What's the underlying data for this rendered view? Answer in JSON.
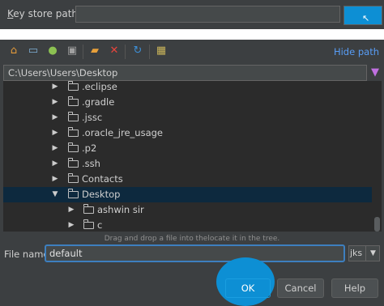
{
  "key_store": {
    "label_key": "K",
    "label_rest": "ey store path:",
    "value": ""
  },
  "toolbar": {
    "icons": [
      "home-icon",
      "desktop-icon",
      "android-icon",
      "project-folder-icon",
      "new-folder-icon",
      "delete-icon",
      "refresh-icon",
      "show-hidden-icon"
    ],
    "hide_path": "Hide path"
  },
  "path": {
    "value": "C:\\Users\\Users\\Desktop"
  },
  "tree": {
    "items": [
      {
        "label": ".eclipse",
        "arrow": "▶"
      },
      {
        "label": ".gradle",
        "arrow": "▶"
      },
      {
        "label": ".jssc",
        "arrow": "▶"
      },
      {
        "label": ".oracle_jre_usage",
        "arrow": "▶"
      },
      {
        "label": ".p2",
        "arrow": "▶"
      },
      {
        "label": ".ssh",
        "arrow": "▶"
      },
      {
        "label": "Contacts",
        "arrow": "▶"
      },
      {
        "label": "Desktop",
        "arrow": "▼"
      },
      {
        "label": "ashwin sir",
        "arrow": "▶"
      },
      {
        "label": "c",
        "arrow": "▶"
      }
    ]
  },
  "hint": "Drag and drop a file into thelocate it in the tree.",
  "file_name": {
    "label": "File name:",
    "value": "default",
    "ext": "jks",
    "ext_arrow": "▼"
  },
  "buttons": {
    "ok": "OK",
    "cancel": "Cancel",
    "help": "Help"
  },
  "colors": {
    "accent": "#0d8fd4",
    "link": "#589df6",
    "selection": "#0d293e",
    "background": "#3c3f41",
    "tree_bg": "#2b2b2b"
  }
}
